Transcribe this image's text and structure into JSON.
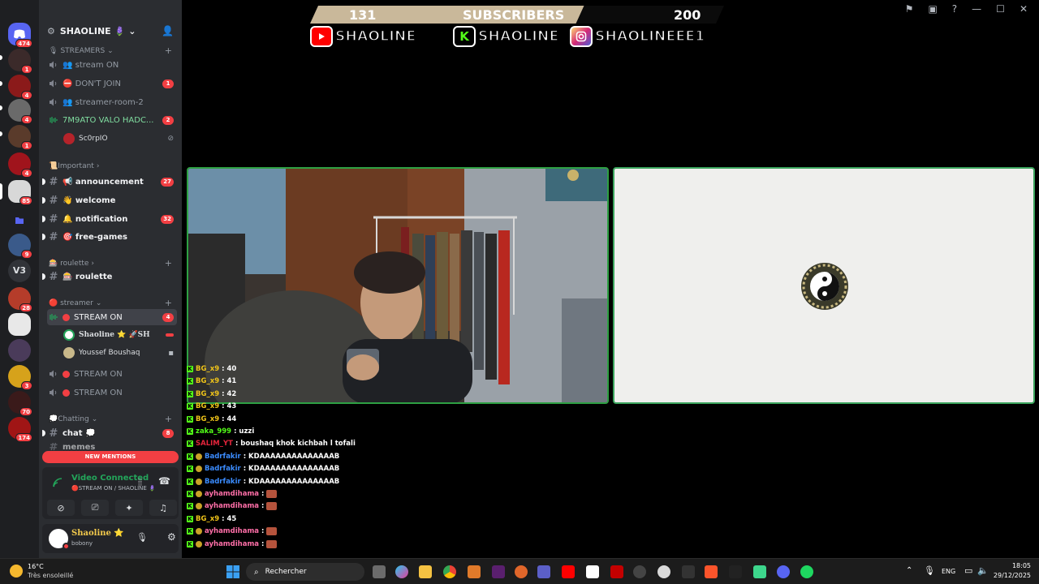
{
  "server_rail": {
    "home_badge": "474",
    "servers": [
      {
        "badge": "1"
      },
      {
        "badge": "4"
      },
      {
        "badge": "4"
      },
      {
        "badge": "1"
      },
      {
        "badge": "4"
      },
      {
        "badge": "85"
      },
      {
        "badge": ""
      },
      {
        "badge": "9"
      },
      {
        "label": "V3",
        "badge": ""
      },
      {
        "badge": "28"
      },
      {
        "badge": ""
      },
      {
        "badge": ""
      },
      {
        "badge": "3"
      },
      {
        "badge": "70"
      },
      {
        "badge": "174"
      }
    ]
  },
  "sidebar": {
    "server_name": "SHAOLINE 🪻",
    "categories": {
      "streamers": "STREAMERS",
      "important": "📜Important",
      "roulette": "🎰 roulette",
      "streamer": "🔴 streamer",
      "chatting": "💭Chatting"
    },
    "voice_channels_top": [
      {
        "label": "👥 stream ON",
        "badge": ""
      },
      {
        "label": "⛔ DON'T JOIN",
        "badge": "1"
      },
      {
        "label": "👥 streamer-room-2",
        "badge": ""
      },
      {
        "label": "7M9ATO VALO HADC...",
        "badge": "2"
      }
    ],
    "voice_user_top": "Sc0rpIO",
    "text_channels": [
      {
        "label": "📢 announcement",
        "badge": "27"
      },
      {
        "label": "👋 welcome",
        "badge": ""
      },
      {
        "label": "🔔 notification",
        "badge": "32"
      },
      {
        "label": "🎯 free-games",
        "badge": ""
      }
    ],
    "roulette_channel": "🎰 roulette",
    "stream_channels": [
      {
        "label": "STREAM ON",
        "badge": "4"
      },
      {
        "label": "STREAM ON",
        "badge": ""
      },
      {
        "label": "STREAM ON",
        "badge": ""
      }
    ],
    "stream_users": [
      {
        "name": "Shaoline ⭐ 🚀SH"
      },
      {
        "name": "Youssef Boushaq"
      }
    ],
    "chat_channel": {
      "label": "chat 💭",
      "badge": "8"
    },
    "new_label": "NEW",
    "new_mentions": "NEW MENTIONS",
    "hidden_channel": "memes"
  },
  "voice_panel": {
    "title": "Video Connected",
    "subtitle": "🔴STREAM ON / SHAOLINE 🪻"
  },
  "user_panel": {
    "name": "Shaoline ⭐",
    "status": "bobony"
  },
  "overlay": {
    "subscribers_current": "131",
    "subscribers_label": "SUBSCRIBERS",
    "subscribers_goal": "200",
    "youtube": "SHAOLINE",
    "kick": "SHAOLINE",
    "instagram": "SHAOLINEEE1",
    "subscriber_progress": 0.655
  },
  "chat": [
    {
      "user": "BG_x9",
      "text": ": 40",
      "color": "#f0c419",
      "icon": "kick"
    },
    {
      "user": "BG_x9",
      "text": ": 41",
      "color": "#f0c419",
      "icon": "kick"
    },
    {
      "user": "BG_x9",
      "text": ": 42",
      "color": "#f0c419",
      "icon": "kick"
    },
    {
      "user": "BG_x9",
      "text": ": 43",
      "color": "#f0c419",
      "icon": "kick"
    },
    {
      "user": "BG_x9",
      "text": ": 44",
      "color": "#f0c419",
      "icon": "kick"
    },
    {
      "user": "zaka_999",
      "text": ": uzzi",
      "color": "#53fc18",
      "icon": "kick"
    },
    {
      "user": "SALIM_YT",
      "text": ": boushaq khok kichbah l tofali",
      "color": "#e5243b",
      "icon": "kick"
    },
    {
      "user": "Badrfakir",
      "text": ": KDAAAAAAAAAAAAAAB",
      "color": "#3b8cff",
      "icon": "kick-mod"
    },
    {
      "user": "Badrfakir",
      "text": ": KDAAAAAAAAAAAAAAB",
      "color": "#3b8cff",
      "icon": "kick-mod"
    },
    {
      "user": "Badrfakir",
      "text": ": KDAAAAAAAAAAAAAAB",
      "color": "#3b8cff",
      "icon": "kick-mod"
    },
    {
      "user": "ayhamdihama",
      "text": ":",
      "color": "#ff6fa8",
      "icon": "kick-mod",
      "emote": true
    },
    {
      "user": "ayhamdihama",
      "text": ":",
      "color": "#ff6fa8",
      "icon": "kick-mod",
      "emote": true
    },
    {
      "user": "BG_x9",
      "text": ": 45",
      "color": "#f0c419",
      "icon": "kick"
    },
    {
      "user": "ayhamdihama",
      "text": ":",
      "color": "#ff6fa8",
      "icon": "kick-mod",
      "emote": true
    },
    {
      "user": "ayhamdihama",
      "text": ":",
      "color": "#ff6fa8",
      "icon": "kick-mod",
      "emote": true
    }
  ],
  "taskbar": {
    "weather_temp": "16°C",
    "weather_desc": "Très ensoleillé",
    "search_placeholder": "Rechercher",
    "language": "ENG",
    "time": "18:05",
    "date": "29/12/2025"
  },
  "colors": {
    "discord_green": "#23a55a",
    "discord_red": "#f23f43",
    "kick_green": "#53fc18",
    "tile_border": "#2ea043"
  }
}
